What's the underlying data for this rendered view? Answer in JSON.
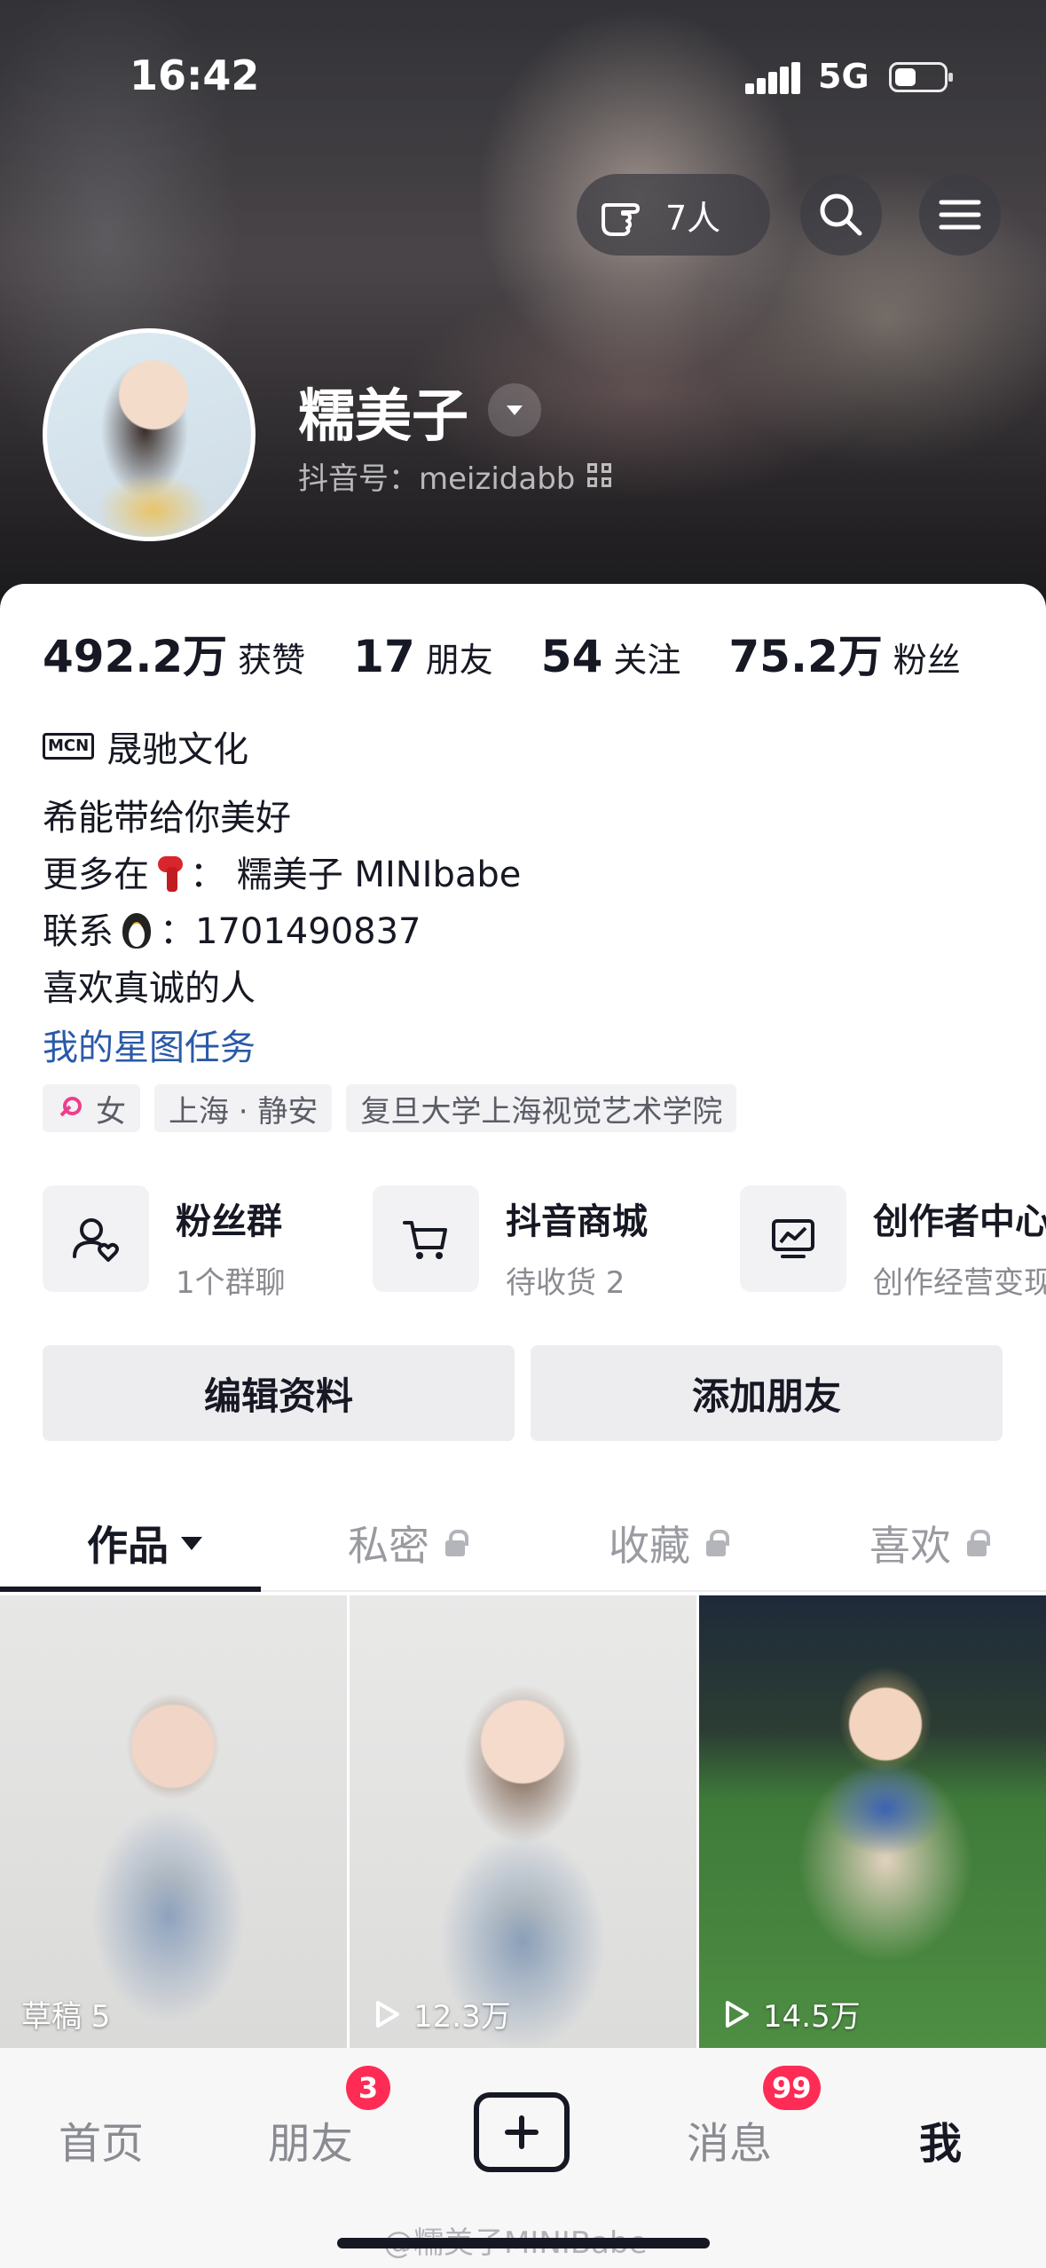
{
  "status_bar": {
    "time": "16:42",
    "network": "5G",
    "battery_level": 0.45
  },
  "header": {
    "visitors_count": "7人",
    "icons": [
      "touch-hand-icon",
      "search-icon",
      "menu-icon"
    ]
  },
  "profile": {
    "nickname": "糯美子",
    "douyin_id": "抖音号：meizidabb"
  },
  "stats": [
    {
      "num": "492.2万",
      "label": "获赞"
    },
    {
      "num": "17",
      "label": "朋友"
    },
    {
      "num": "54",
      "label": "关注"
    },
    {
      "num": "75.2万",
      "label": "粉丝"
    }
  ],
  "mcn": {
    "badge": "MCN",
    "name": "晟驰文化"
  },
  "bio": {
    "line1": "希能带给你美好",
    "line2_prefix": "更多在",
    "line2_suffix": "： 糯美子 MINIbabe",
    "line3_prefix": "联系",
    "line3_suffix": "：1701490837",
    "line4": "喜欢真诚的人"
  },
  "star_task": "我的星图任务",
  "tags": {
    "gender": "女",
    "location": "上海 · 静安",
    "school": "复旦大学上海视觉艺术学院"
  },
  "services": [
    {
      "title": "粉丝群",
      "sub": "1个群聊"
    },
    {
      "title": "抖音商城",
      "sub": "待收货 2"
    },
    {
      "title": "创作者中心",
      "sub": "创作经营变现"
    }
  ],
  "actions": {
    "edit": "编辑资料",
    "add_friend": "添加朋友"
  },
  "tabs": [
    {
      "label": "作品",
      "active": true
    },
    {
      "label": "私密",
      "locked": true
    },
    {
      "label": "收藏",
      "locked": true
    },
    {
      "label": "喜欢",
      "locked": true
    }
  ],
  "videos": [
    {
      "label": "草稿 5"
    },
    {
      "label": "12.3万"
    },
    {
      "label": "14.5万"
    }
  ],
  "bottom_nav": {
    "home": "首页",
    "friends": "朋友",
    "friends_badge": "3",
    "messages": "消息",
    "messages_badge": "99",
    "me": "我"
  },
  "watermark": "@糯美子MINIBabe",
  "colors": {
    "accent_red": "#fe2c55",
    "link_blue": "#2a5aa8",
    "female_pink": "#ee3e8c"
  }
}
